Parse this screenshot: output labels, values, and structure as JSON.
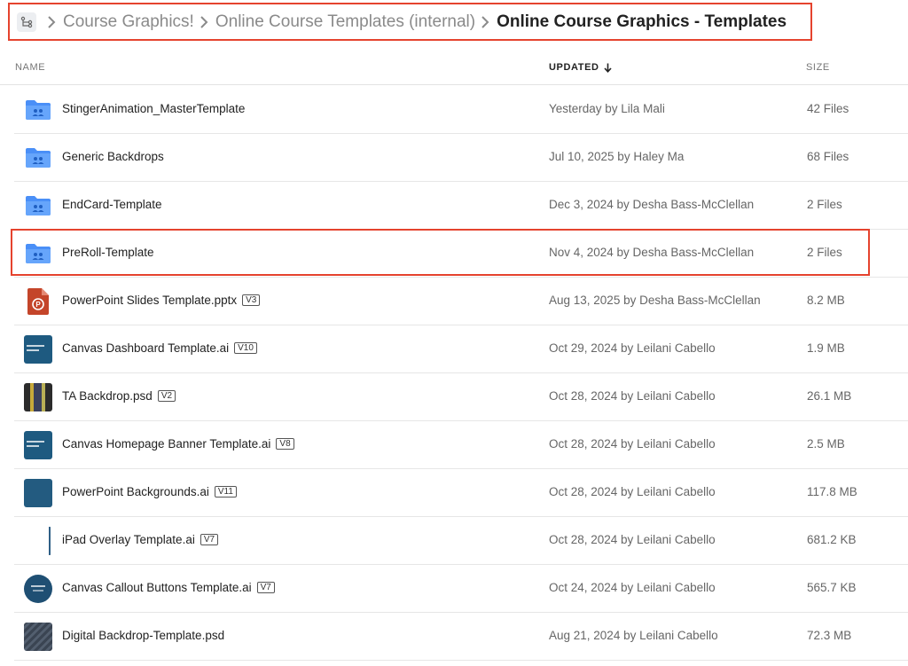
{
  "breadcrumb": {
    "items": [
      {
        "label": "Course Graphics!"
      },
      {
        "label": "Online Course Templates (internal)"
      },
      {
        "label": "Online Course Graphics - Templates"
      }
    ]
  },
  "table": {
    "headers": {
      "name": "NAME",
      "updated": "UPDATED",
      "size": "SIZE"
    },
    "rows": [
      {
        "icon": "shared-folder-icon",
        "name": "StingerAnimation_MasterTemplate",
        "version": "",
        "updated": "Yesterday by Lila Mali",
        "size": "42 Files"
      },
      {
        "icon": "shared-folder-icon",
        "name": "Generic Backdrops",
        "version": "",
        "updated": "Jul 10, 2025 by Haley Ma",
        "size": "68 Files"
      },
      {
        "icon": "shared-folder-icon",
        "name": "EndCard-Template",
        "version": "",
        "updated": "Dec 3, 2024 by Desha Bass-McClellan",
        "size": "2 Files"
      },
      {
        "icon": "shared-folder-icon",
        "name": "PreRoll-Template",
        "version": "",
        "updated": "Nov 4, 2024 by Desha Bass-McClellan",
        "size": "2 Files"
      },
      {
        "icon": "powerpoint-file-icon",
        "name": "PowerPoint Slides Template.pptx",
        "version": "V3",
        "updated": "Aug 13, 2025 by Desha Bass-McClellan",
        "size": "8.2 MB"
      },
      {
        "icon": "ai-file-thumbnail",
        "name": "Canvas Dashboard Template.ai",
        "version": "V10",
        "updated": "Oct 29, 2024 by Leilani Cabello",
        "size": "1.9 MB"
      },
      {
        "icon": "psd-file-thumbnail",
        "name": "TA Backdrop.psd",
        "version": "V2",
        "updated": "Oct 28, 2024 by Leilani Cabello",
        "size": "26.1 MB"
      },
      {
        "icon": "ai-file-thumbnail",
        "name": "Canvas Homepage Banner Template.ai",
        "version": "V8",
        "updated": "Oct 28, 2024 by Leilani Cabello",
        "size": "2.5 MB"
      },
      {
        "icon": "ai-file-thumbnail",
        "name": "PowerPoint Backgrounds.ai",
        "version": "V11",
        "updated": "Oct 28, 2024 by Leilani Cabello",
        "size": "117.8 MB"
      },
      {
        "icon": "ai-file-thumbnail",
        "name": "iPad Overlay Template.ai",
        "version": "V7",
        "updated": "Oct 28, 2024 by Leilani Cabello",
        "size": "681.2 KB"
      },
      {
        "icon": "ai-file-thumbnail",
        "name": "Canvas Callout Buttons Template.ai",
        "version": "V7",
        "updated": "Oct 24, 2024 by Leilani Cabello",
        "size": "565.7 KB"
      },
      {
        "icon": "psd-file-thumbnail",
        "name": "Digital Backdrop-Template.psd",
        "version": "",
        "updated": "Aug 21, 2024 by Leilani Cabello",
        "size": "72.3 MB"
      }
    ]
  },
  "colors": {
    "highlight": "#e5432e",
    "folder": "#4a8ff7",
    "powerpoint": "#c4452a"
  }
}
